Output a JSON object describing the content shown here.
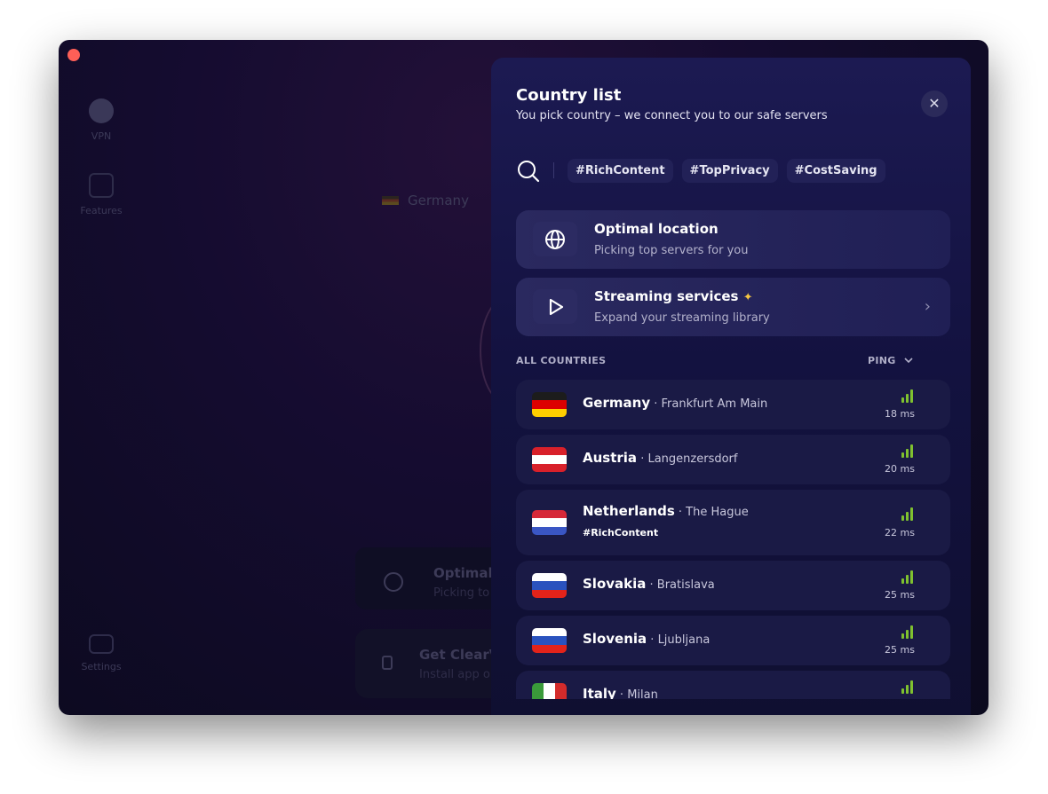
{
  "background": {
    "sidebar": [
      {
        "label": "VPN",
        "icon": "globe-icon"
      },
      {
        "label": "Features",
        "icon": "puzzle-icon"
      },
      {
        "label": "Settings",
        "icon": "settings-icon"
      }
    ],
    "location": "Germany",
    "optimal_title": "Optimal",
    "optimal_sub": "Picking to",
    "get_title": "Get ClearV",
    "get_sub": "Install app o"
  },
  "panel": {
    "title": "Country list",
    "subtitle": "You pick country – we connect you to our safe servers",
    "close": "✕",
    "tags": [
      "#RichContent",
      "#TopPrivacy",
      "#CostSaving"
    ],
    "optimal": {
      "title": "Optimal location",
      "subtitle": "Picking top servers for you",
      "icon": "globe-icon"
    },
    "streaming": {
      "title": "Streaming services",
      "subtitle": "Expand your streaming library",
      "icon": "play-icon",
      "sparkle": "sparkle-icon"
    },
    "all_countries": "ALL COUNTRIES",
    "sort": "PING",
    "signal_color": "#7fc12f",
    "countries": [
      {
        "name": "Germany",
        "city": "Frankfurt Am Main",
        "ping": "18 ms",
        "flag": [
          "#1c1c1c",
          "#dd0000",
          "#ffce00"
        ]
      },
      {
        "name": "Austria",
        "city": "Langenzersdorf",
        "ping": "20 ms",
        "flag": [
          "#d8202a",
          "#ffffff",
          "#d8202a"
        ]
      },
      {
        "name": "Netherlands",
        "city": "The Hague",
        "tag": "#RichContent",
        "ping": "22 ms",
        "flag": [
          "#d62838",
          "#ffffff",
          "#3a56c4"
        ]
      },
      {
        "name": "Slovakia",
        "city": "Bratislava",
        "ping": "25 ms",
        "flag": [
          "#ffffff",
          "#2a52be",
          "#e2231a"
        ]
      },
      {
        "name": "Slovenia",
        "city": "Ljubljana",
        "ping": "25 ms",
        "flag": [
          "#ffffff",
          "#2a52be",
          "#e2231a"
        ]
      },
      {
        "name": "Italy",
        "city": "Milan",
        "ping": "",
        "flag": [
          "#3a9a3a",
          "#ffffff",
          "#d32b2b"
        ]
      }
    ]
  }
}
